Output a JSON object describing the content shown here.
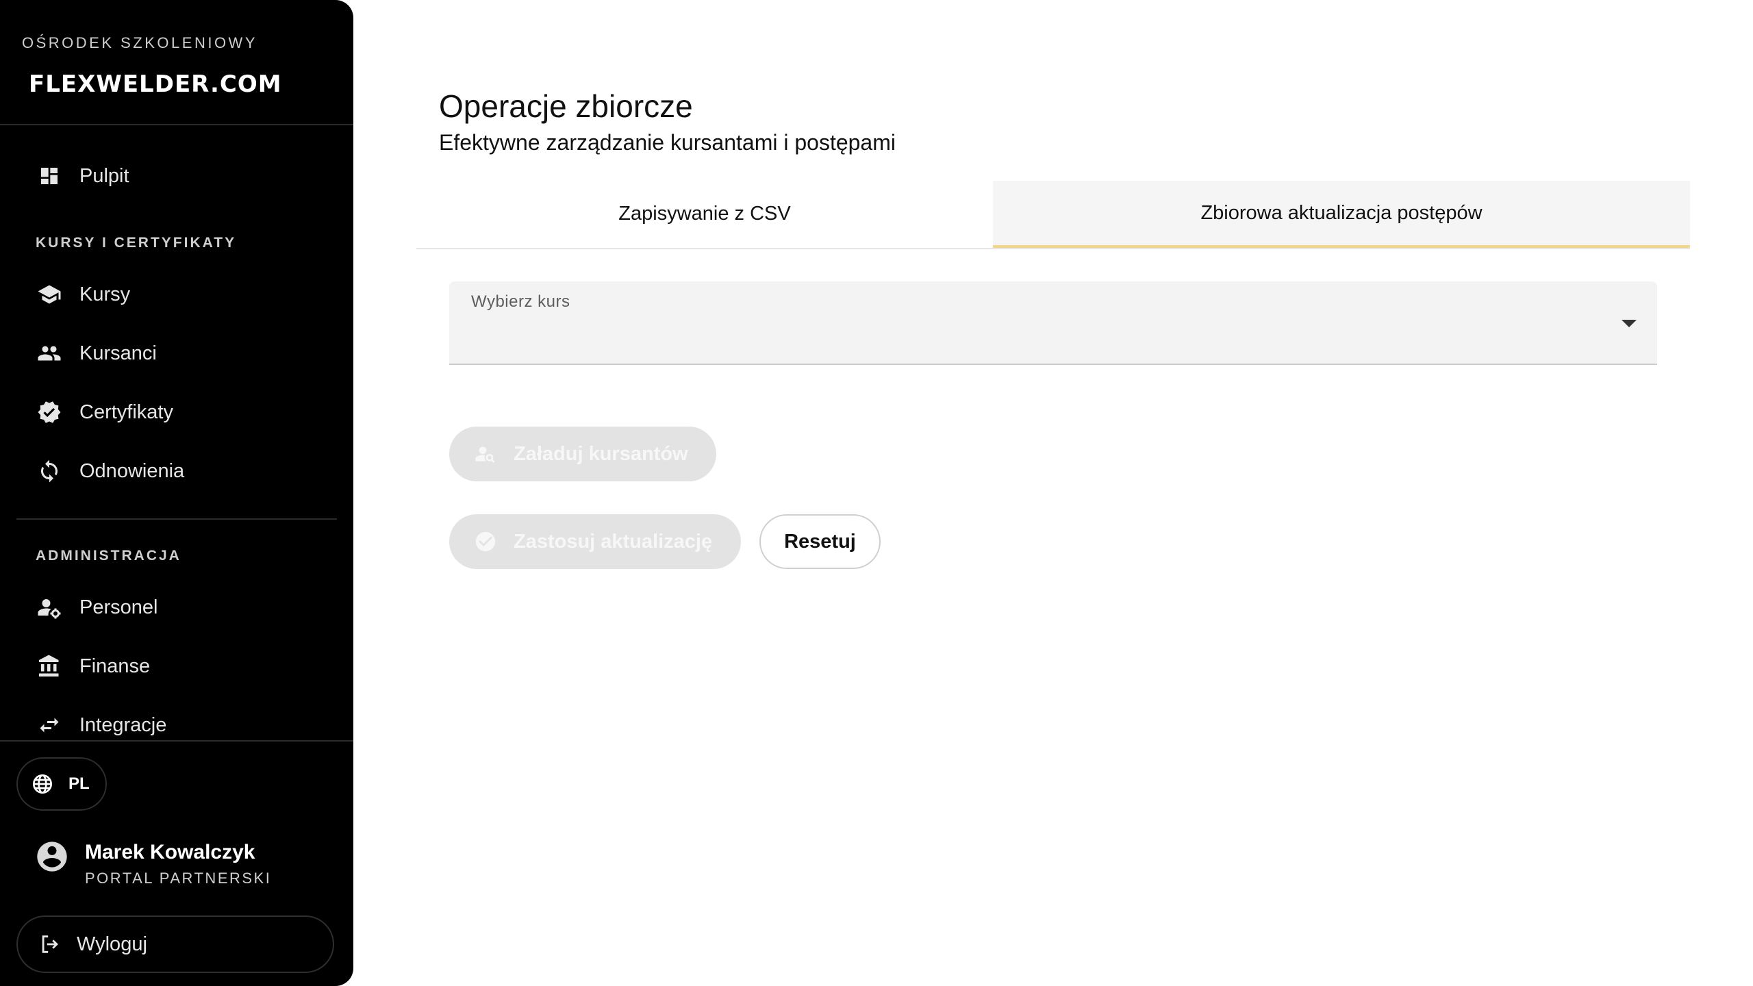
{
  "sidebar": {
    "org_label": "OŚRODEK SZKOLENIOWY",
    "brand": "FLEXWELDER.COM",
    "items_top": [
      {
        "label": "Pulpit",
        "icon": "dashboard-icon"
      }
    ],
    "section_courses": "KURSY I CERTYFIKATY",
    "items_courses": [
      {
        "label": "Kursy",
        "icon": "graduation-cap-icon"
      },
      {
        "label": "Kursanci",
        "icon": "people-icon"
      },
      {
        "label": "Certyfikaty",
        "icon": "verified-badge-icon"
      },
      {
        "label": "Odnowienia",
        "icon": "sync-icon"
      }
    ],
    "section_admin": "ADMINISTRACJA",
    "items_admin": [
      {
        "label": "Personel",
        "icon": "user-settings-icon"
      },
      {
        "label": "Finanse",
        "icon": "bank-icon"
      },
      {
        "label": "Integracje",
        "icon": "swap-arrows-icon"
      }
    ],
    "language": "PL",
    "user": {
      "name": "Marek Kowalczyk",
      "role": "PORTAL PARTNERSKI"
    },
    "logout": "Wyloguj"
  },
  "main": {
    "title": "Operacje zbiorcze",
    "subtitle": "Efektywne zarządzanie kursantami i postępami",
    "tabs": [
      {
        "label": "Zapisywanie z CSV",
        "active": false
      },
      {
        "label": "Zbiorowa aktualizacja postępów",
        "active": true
      }
    ],
    "course_select": {
      "label": "Wybierz kurs",
      "value": ""
    },
    "load_button": "Załaduj kursantów",
    "apply_button": "Zastosuj aktualizację",
    "reset_button": "Resetuj"
  },
  "colors": {
    "sidebar_bg": "#000000",
    "tab_active_indicator": "#f0d58a",
    "disabled_button_bg": "#e3e3e3"
  }
}
